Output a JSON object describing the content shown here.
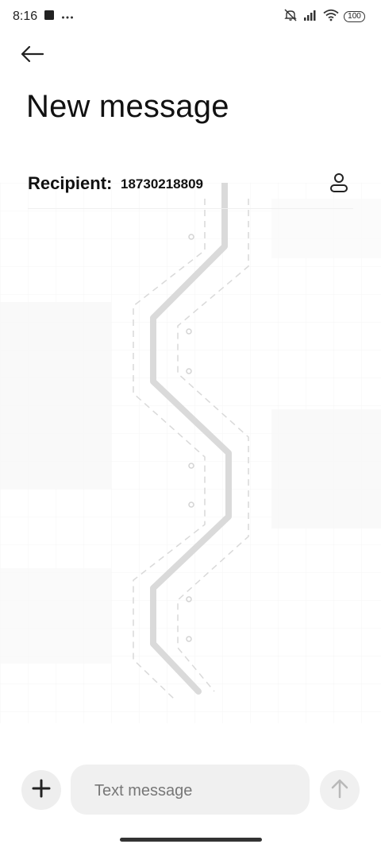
{
  "status_bar": {
    "time": "8:16",
    "battery_level": "100",
    "left_icons": [
      "notification-square-icon",
      "more-dots-icon"
    ],
    "right_icons": [
      "mute-icon",
      "signal-icon",
      "wifi-icon",
      "battery-icon"
    ]
  },
  "header": {
    "back_icon": "arrow-left-icon",
    "title": "New message"
  },
  "recipient": {
    "label": "Recipient:",
    "value": "18730218809",
    "contact_icon": "person-icon"
  },
  "composer": {
    "attach_icon": "plus-icon",
    "placeholder": "Text message",
    "value": "",
    "send_icon": "arrow-up-icon"
  },
  "colors": {
    "background": "#ffffff",
    "text": "#111111",
    "composer_fill": "#f0f0f0",
    "send_icon": "#b9b9b9",
    "art_line": "#d6d6d6"
  }
}
